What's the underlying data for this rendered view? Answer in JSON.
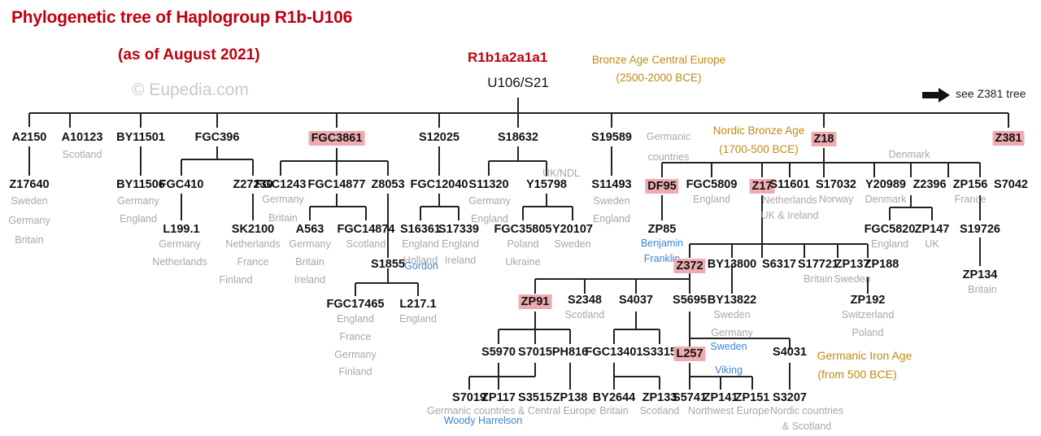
{
  "header": {
    "title": "Phylogenetic tree of Haplogroup R1b-U106",
    "subtitle": "(as of August 2021)",
    "watermark": "© Eupedia.com",
    "haplogroup_name": "R1b1a2a1a1",
    "root_node": "U106/S21",
    "see_also": "see Z381 tree",
    "arrow_icon": "right-arrow-icon"
  },
  "eras": [
    {
      "line1": "Bronze Age Central Europe",
      "line2": "(2500-2000 BCE)"
    },
    {
      "line1": "Nordic Bronze Age",
      "line2": "(1700-500 BCE)"
    },
    {
      "line1": "Germanic Iron Age",
      "line2": "(from 500 BCE)"
    }
  ],
  "colors": {
    "title_red": "#c00010",
    "highlight_pink": "#eeacb0",
    "geo_grey": "#a8a8a8",
    "person_blue": "#3b86d0",
    "era_gold": "#c08a14",
    "line_black": "#222222"
  },
  "nodes": [
    {
      "id": "A2150",
      "label": "A2150"
    },
    {
      "id": "A10123",
      "label": "A10123"
    },
    {
      "id": "BY11501",
      "label": "BY11501"
    },
    {
      "id": "FGC396",
      "label": "FGC396"
    },
    {
      "id": "FGC3861",
      "label": "FGC3861",
      "highlight": true
    },
    {
      "id": "S12025",
      "label": "S12025"
    },
    {
      "id": "S18632",
      "label": "S18632"
    },
    {
      "id": "S19589",
      "label": "S19589"
    },
    {
      "id": "Z18",
      "label": "Z18",
      "highlight": true
    },
    {
      "id": "Z381",
      "label": "Z381",
      "highlight": true
    },
    {
      "id": "Z17640",
      "label": "Z17640"
    },
    {
      "id": "BY11506",
      "label": "BY11506"
    },
    {
      "id": "FGC410",
      "label": "FGC410"
    },
    {
      "id": "Z27230",
      "label": "Z27230"
    },
    {
      "id": "L199.1",
      "label": "L199.1"
    },
    {
      "id": "SK2100",
      "label": "SK2100"
    },
    {
      "id": "FGC1243",
      "label": "FGC1243"
    },
    {
      "id": "FGC14877",
      "label": "FGC14877"
    },
    {
      "id": "Z8053",
      "label": "Z8053"
    },
    {
      "id": "A563",
      "label": "A563"
    },
    {
      "id": "FGC14874",
      "label": "FGC14874"
    },
    {
      "id": "S1855",
      "label": "S1855"
    },
    {
      "id": "FGC17465",
      "label": "FGC17465"
    },
    {
      "id": "L217.1",
      "label": "L217.1"
    },
    {
      "id": "FGC12040",
      "label": "FGC12040"
    },
    {
      "id": "S16361",
      "label": "S16361"
    },
    {
      "id": "S17339",
      "label": "S17339"
    },
    {
      "id": "S11320",
      "label": "S11320"
    },
    {
      "id": "Y15798",
      "label": "Y15798"
    },
    {
      "id": "FGC35805",
      "label": "FGC35805"
    },
    {
      "id": "Y20107",
      "label": "Y20107"
    },
    {
      "id": "S11493",
      "label": "S11493"
    },
    {
      "id": "DF95",
      "label": "DF95",
      "highlight": true
    },
    {
      "id": "FGC5809",
      "label": "FGC5809"
    },
    {
      "id": "Z17",
      "label": "Z17",
      "highlight": true
    },
    {
      "id": "S11601",
      "label": "S11601"
    },
    {
      "id": "S17032",
      "label": "S17032"
    },
    {
      "id": "Y20989",
      "label": "Y20989"
    },
    {
      "id": "Z2396",
      "label": "Z2396"
    },
    {
      "id": "ZP156",
      "label": "ZP156"
    },
    {
      "id": "S7042",
      "label": "S7042"
    },
    {
      "id": "ZP85",
      "label": "ZP85"
    },
    {
      "id": "FGC5820",
      "label": "FGC5820"
    },
    {
      "id": "ZP147",
      "label": "ZP147"
    },
    {
      "id": "S19726",
      "label": "S19726"
    },
    {
      "id": "ZP134",
      "label": "ZP134"
    },
    {
      "id": "Z372",
      "label": "Z372",
      "highlight": true
    },
    {
      "id": "BY13800",
      "label": "BY13800"
    },
    {
      "id": "S6317",
      "label": "S6317"
    },
    {
      "id": "S17721",
      "label": "S17721"
    },
    {
      "id": "ZP137",
      "label": "ZP137"
    },
    {
      "id": "ZP188",
      "label": "ZP188"
    },
    {
      "id": "ZP192",
      "label": "ZP192"
    },
    {
      "id": "ZP91",
      "label": "ZP91",
      "highlight": true
    },
    {
      "id": "S2348",
      "label": "S2348"
    },
    {
      "id": "S4037",
      "label": "S4037"
    },
    {
      "id": "S5695",
      "label": "S5695"
    },
    {
      "id": "BY13822",
      "label": "BY13822"
    },
    {
      "id": "S5970",
      "label": "S5970"
    },
    {
      "id": "S7015",
      "label": "S7015"
    },
    {
      "id": "PH816",
      "label": "PH816"
    },
    {
      "id": "FGC13401",
      "label": "FGC13401"
    },
    {
      "id": "S3315",
      "label": "S3315"
    },
    {
      "id": "L257",
      "label": "L257",
      "highlight": true
    },
    {
      "id": "S4031",
      "label": "S4031"
    },
    {
      "id": "S7019",
      "label": "S7019"
    },
    {
      "id": "ZP117",
      "label": "ZP117"
    },
    {
      "id": "S3515",
      "label": "S3515"
    },
    {
      "id": "ZP138",
      "label": "ZP138"
    },
    {
      "id": "BY2644",
      "label": "BY2644"
    },
    {
      "id": "ZP133",
      "label": "ZP133"
    },
    {
      "id": "S5741",
      "label": "S5741"
    },
    {
      "id": "ZP141",
      "label": "ZP141"
    },
    {
      "id": "ZP151",
      "label": "ZP151"
    },
    {
      "id": "S3207",
      "label": "S3207"
    }
  ],
  "geo": [
    "Scotland",
    "Sweden",
    "Germany",
    "Britain",
    "Germany",
    "England",
    "Germany",
    "Netherlands",
    "France",
    "Finland",
    "Netherlands",
    "Germany",
    "Britain",
    "Germany",
    "Britain",
    "Ireland",
    "Scotland",
    "Holland",
    "Ireland",
    "England",
    "England",
    "England",
    "France",
    "Germany",
    "Finland",
    "England",
    "UK/NDL",
    "Germany",
    "England",
    "Poland",
    "Ukraine",
    "Sweden",
    "Sweden",
    "England",
    "Germanic",
    "countries",
    "England",
    "Netherlands",
    "UK & Ireland",
    "Norway",
    "Denmark",
    "Denmark",
    "France",
    "England",
    "UK",
    "Britain",
    "Britain",
    "Sweden",
    "Switzerland",
    "Poland",
    "Scotland",
    "Sweden",
    "Germany",
    "Germanic countries & Central Europe",
    "Britain",
    "Scotland",
    "Northwest Europe",
    "Nordic countries",
    "& Scotland"
  ],
  "persons": [
    "Gordon",
    "Benjamin",
    "Franklin",
    "Sweden",
    "Viking",
    "Woody Harrelson"
  ],
  "annotations": {
    "a2150_geo": [
      "Sweden",
      "Germany",
      "Britain"
    ],
    "a10123_geo": [
      "Scotland"
    ],
    "by11506_geo": [
      "Germany",
      "England"
    ],
    "l199_geo": [
      "Germany",
      "Netherlands"
    ],
    "sk2100_geo": [
      "Netherlands",
      "France",
      "Finland"
    ],
    "fgc1243_geo": [
      "Germany",
      "Britain"
    ],
    "a563_geo": [
      "Germany",
      "Britain",
      "Ireland"
    ],
    "fgc14874_geo": [
      "Scotland"
    ],
    "fgc17465_geo": [
      "England",
      "France",
      "Germany",
      "Finland"
    ],
    "l217_geo": [
      "England"
    ],
    "s16361_geo": [
      "England",
      "Holland"
    ],
    "s17339_geo": [
      "England",
      "Ireland"
    ],
    "s11320_geo": [
      "Germany",
      "England"
    ],
    "y15798_geo": [
      "UK/NDL"
    ],
    "fgc35805_geo": [
      "Poland",
      "Ukraine"
    ],
    "y20107_geo": [
      "Sweden"
    ],
    "s11493_geo": [
      "Sweden",
      "England"
    ],
    "u106_geo": [
      "Germanic",
      "countries"
    ],
    "fgc5809_geo": [
      "England"
    ],
    "s11601_geo": [
      "Netherlands",
      "UK & Ireland"
    ],
    "s17032_geo": [
      "Norway"
    ],
    "y20989_geo": [
      "Denmark"
    ],
    "z18_geo": [
      "Denmark"
    ],
    "zp156_geo": [
      "France"
    ],
    "fgc5820_geo": [
      "England"
    ],
    "zp147_geo": [
      "UK"
    ],
    "zp134_geo": [
      "Britain"
    ],
    "zp85_person": [
      "Benjamin",
      "Franklin"
    ],
    "s1855_person": [
      "Gordon"
    ],
    "s17721_geo": [
      "Britain"
    ],
    "zp137_geo": [
      "Sweden"
    ],
    "zp192_geo": [
      "Switzerland",
      "Poland"
    ],
    "s2348_geo": [
      "Scotland"
    ],
    "by13822_geo": [
      "Sweden",
      "Germany"
    ],
    "l257_person": [
      "Sweden",
      "Viking"
    ],
    "bottom_geo_1": "Germanic countries & Central Europe",
    "bottom_person": "Woody Harrelson",
    "by2644_geo": "Britain",
    "zp133_geo": "Scotland",
    "northwest": "Northwest Europe",
    "nordic1": "Nordic countries",
    "nordic2": "& Scotland"
  }
}
